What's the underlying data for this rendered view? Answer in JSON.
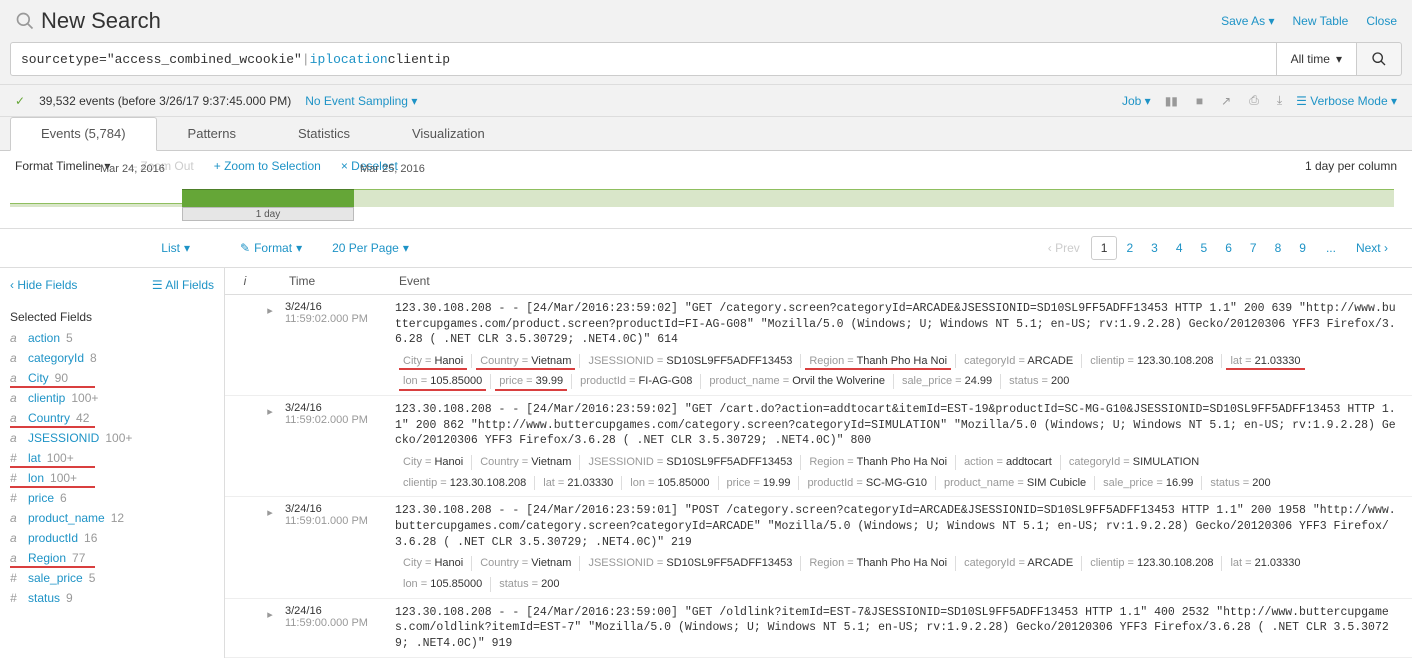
{
  "header": {
    "title": "New Search",
    "saveAs": "Save As",
    "newTable": "New Table",
    "close": "Close"
  },
  "search": {
    "token_str": "sourcetype=\"access_combined_wcookie\"",
    "token_pipe": " | ",
    "token_cmd": "iplocation",
    "token_arg": " clientip",
    "timeRange": "All time"
  },
  "status": {
    "eventsText": "39,532 events (before 3/26/17 9:37:45.000 PM)",
    "sampling": "No Event Sampling",
    "job": "Job",
    "verbose": "Verbose Mode"
  },
  "tabs": {
    "events": "Events (5,784)",
    "patterns": "Patterns",
    "statistics": "Statistics",
    "visualization": "Visualization"
  },
  "timeline": {
    "format": "Format Timeline",
    "zoomOut": "– Zoom Out",
    "zoomSel": "+ Zoom to Selection",
    "deselect": "× Deselect",
    "perColumn": "1 day per column",
    "d1": "Mar 24, 2016",
    "d2": "Mar 25, 2016",
    "sel": "1 day"
  },
  "sidebar": {
    "hide": "Hide Fields",
    "all": "All Fields",
    "selected": "Selected Fields",
    "fields": [
      {
        "t": "a",
        "n": "action",
        "c": "5",
        "hl": false
      },
      {
        "t": "a",
        "n": "categoryId",
        "c": "8",
        "hl": false
      },
      {
        "t": "a",
        "n": "City",
        "c": "90",
        "hl": true
      },
      {
        "t": "a",
        "n": "clientip",
        "c": "100+",
        "hl": false
      },
      {
        "t": "a",
        "n": "Country",
        "c": "42",
        "hl": true
      },
      {
        "t": "a",
        "n": "JSESSIONID",
        "c": "100+",
        "hl": false
      },
      {
        "t": "#",
        "n": "lat",
        "c": "100+",
        "hl": true
      },
      {
        "t": "#",
        "n": "lon",
        "c": "100+",
        "hl": true
      },
      {
        "t": "#",
        "n": "price",
        "c": "6",
        "hl": false
      },
      {
        "t": "a",
        "n": "product_name",
        "c": "12",
        "hl": false
      },
      {
        "t": "a",
        "n": "productId",
        "c": "16",
        "hl": false
      },
      {
        "t": "a",
        "n": "Region",
        "c": "77",
        "hl": true
      },
      {
        "t": "#",
        "n": "sale_price",
        "c": "5",
        "hl": false
      },
      {
        "t": "#",
        "n": "status",
        "c": "9",
        "hl": false
      }
    ]
  },
  "listToolbar": {
    "list": "List",
    "format": "Format",
    "perPage": "20 Per Page",
    "prev": "Prev",
    "next": "Next",
    "pages": [
      "1",
      "2",
      "3",
      "4",
      "5",
      "6",
      "7",
      "8",
      "9"
    ],
    "dots": "..."
  },
  "tableHead": {
    "i": "i",
    "time": "Time",
    "event": "Event"
  },
  "events": [
    {
      "date": "3/24/16",
      "time": "11:59:02.000 PM",
      "raw": "123.30.108.208 - - [24/Mar/2016:23:59:02] \"GET /category.screen?categoryId=ARCADE&JSESSIONID=SD10SL9FF5ADFF13453 HTTP 1.1\" 200 639 \"http://www.buttercupgames.com/product.screen?productId=FI-AG-G08\" \"Mozilla/5.0 (Windows; U; Windows NT 5.1; en-US; rv:1.9.2.28) Gecko/20120306 YFF3 Firefox/3.6.28 ( .NET CLR 3.5.30729; .NET4.0C)\" 614",
      "kv1": [
        {
          "k": "City",
          "v": "Hanoi",
          "hl": true
        },
        {
          "k": "Country",
          "v": "Vietnam",
          "hl": true
        },
        {
          "k": "JSESSIONID",
          "v": "SD10SL9FF5ADFF13453",
          "hl": false
        },
        {
          "k": "Region",
          "v": "Thanh Pho Ha Noi",
          "hl": true
        },
        {
          "k": "categoryId",
          "v": "ARCADE",
          "hl": false
        },
        {
          "k": "clientip",
          "v": "123.30.108.208",
          "hl": false
        },
        {
          "k": "lat",
          "v": "21.03330",
          "hl": true
        }
      ],
      "kv2": [
        {
          "k": "lon",
          "v": "105.85000",
          "hl": true
        },
        {
          "k": "price",
          "v": "39.99",
          "hl": true
        },
        {
          "k": "productId",
          "v": "FI-AG-G08",
          "hl": false
        },
        {
          "k": "product_name",
          "v": "Orvil the Wolverine",
          "hl": false
        },
        {
          "k": "sale_price",
          "v": "24.99",
          "hl": false
        },
        {
          "k": "status",
          "v": "200",
          "hl": false
        }
      ]
    },
    {
      "date": "3/24/16",
      "time": "11:59:02.000 PM",
      "raw": "123.30.108.208 - - [24/Mar/2016:23:59:02] \"GET /cart.do?action=addtocart&itemId=EST-19&productId=SC-MG-G10&JSESSIONID=SD10SL9FF5ADFF13453 HTTP 1.1\" 200 862 \"http://www.buttercupgames.com/category.screen?categoryId=SIMULATION\" \"Mozilla/5.0 (Windows; U; Windows NT 5.1; en-US; rv:1.9.2.28) Gecko/20120306 YFF3 Firefox/3.6.28 ( .NET CLR 3.5.30729; .NET4.0C)\" 800",
      "kv1": [
        {
          "k": "City",
          "v": "Hanoi",
          "hl": false
        },
        {
          "k": "Country",
          "v": "Vietnam",
          "hl": false
        },
        {
          "k": "JSESSIONID",
          "v": "SD10SL9FF5ADFF13453",
          "hl": false
        },
        {
          "k": "Region",
          "v": "Thanh Pho Ha Noi",
          "hl": false
        },
        {
          "k": "action",
          "v": "addtocart",
          "hl": false
        },
        {
          "k": "categoryId",
          "v": "SIMULATION",
          "hl": false
        }
      ],
      "kv2": [
        {
          "k": "clientip",
          "v": "123.30.108.208",
          "hl": false
        },
        {
          "k": "lat",
          "v": "21.03330",
          "hl": false
        },
        {
          "k": "lon",
          "v": "105.85000",
          "hl": false
        },
        {
          "k": "price",
          "v": "19.99",
          "hl": false
        },
        {
          "k": "productId",
          "v": "SC-MG-G10",
          "hl": false
        },
        {
          "k": "product_name",
          "v": "SIM Cubicle",
          "hl": false
        },
        {
          "k": "sale_price",
          "v": "16.99",
          "hl": false
        },
        {
          "k": "status",
          "v": "200",
          "hl": false
        }
      ]
    },
    {
      "date": "3/24/16",
      "time": "11:59:01.000 PM",
      "raw": "123.30.108.208 - - [24/Mar/2016:23:59:01] \"POST /category.screen?categoryId=ARCADE&JSESSIONID=SD10SL9FF5ADFF13453 HTTP 1.1\" 200 1958 \"http://www.buttercupgames.com/category.screen?categoryId=ARCADE\" \"Mozilla/5.0 (Windows; U; Windows NT 5.1; en-US; rv:1.9.2.28) Gecko/20120306 YFF3 Firefox/3.6.28 ( .NET CLR 3.5.30729; .NET4.0C)\" 219",
      "kv1": [
        {
          "k": "City",
          "v": "Hanoi",
          "hl": false
        },
        {
          "k": "Country",
          "v": "Vietnam",
          "hl": false
        },
        {
          "k": "JSESSIONID",
          "v": "SD10SL9FF5ADFF13453",
          "hl": false
        },
        {
          "k": "Region",
          "v": "Thanh Pho Ha Noi",
          "hl": false
        },
        {
          "k": "categoryId",
          "v": "ARCADE",
          "hl": false
        },
        {
          "k": "clientip",
          "v": "123.30.108.208",
          "hl": false
        },
        {
          "k": "lat",
          "v": "21.03330",
          "hl": false
        }
      ],
      "kv2": [
        {
          "k": "lon",
          "v": "105.85000",
          "hl": false
        },
        {
          "k": "status",
          "v": "200",
          "hl": false
        }
      ]
    },
    {
      "date": "3/24/16",
      "time": "11:59:00.000 PM",
      "raw": "123.30.108.208 - - [24/Mar/2016:23:59:00] \"GET /oldlink?itemId=EST-7&JSESSIONID=SD10SL9FF5ADFF13453 HTTP 1.1\" 400 2532 \"http://www.buttercupgames.com/oldlink?itemId=EST-7\" \"Mozilla/5.0 (Windows; U; Windows NT 5.1; en-US; rv:1.9.2.28) Gecko/20120306 YFF3 Firefox/3.6.28 ( .NET CLR 3.5.30729; .NET4.0C)\" 919",
      "kv1": [],
      "kv2": []
    }
  ]
}
